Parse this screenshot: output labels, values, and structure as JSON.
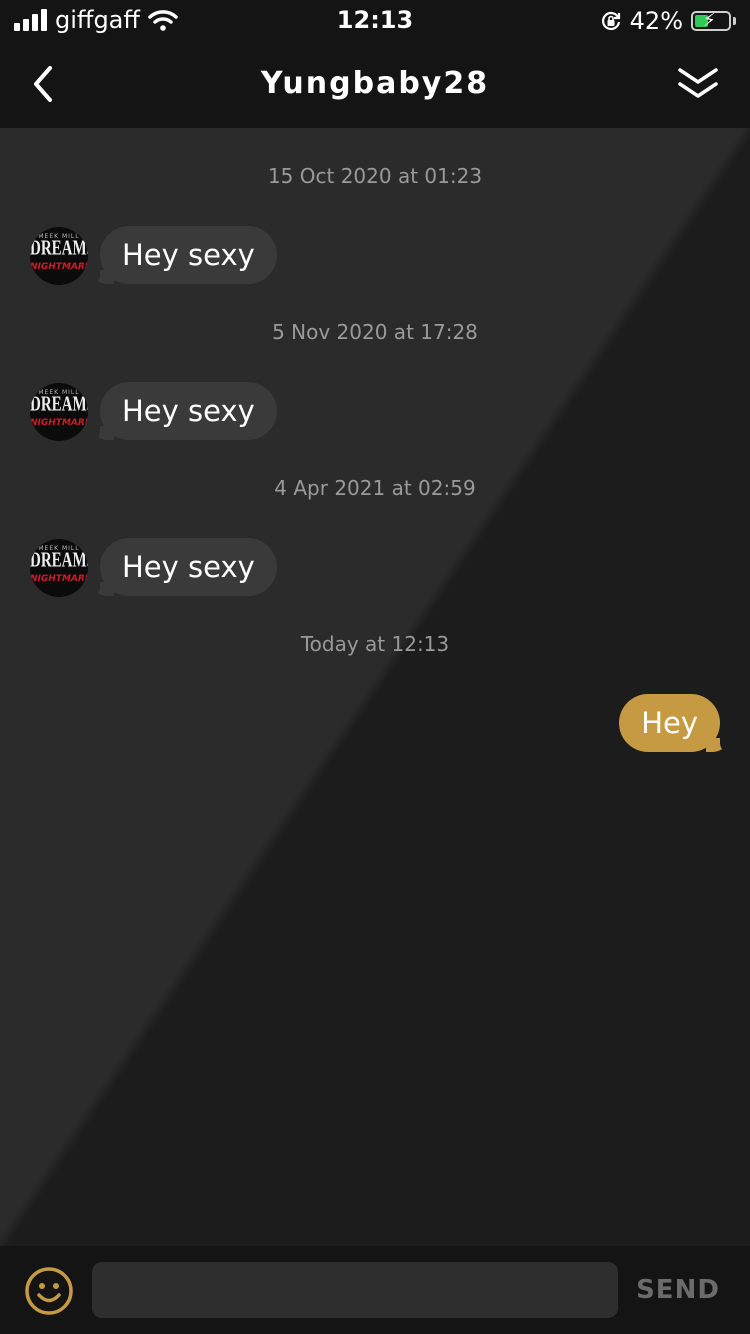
{
  "status_bar": {
    "carrier": "giffgaff",
    "time": "12:13",
    "battery_percent": "42%",
    "battery_level": 0.42,
    "battery_color": "#31c957"
  },
  "header": {
    "title": "Yungbaby28",
    "back_icon": "chevron-left-icon",
    "collapse_icon": "double-chevron-down-icon"
  },
  "avatar": {
    "line1": "MEEK MILL",
    "line2": "DREAMS",
    "line3": "NIGHTMARES"
  },
  "messages": [
    {
      "timestamp": "15 Oct 2020 at 01:23",
      "text": "Hey sexy",
      "direction": "incoming"
    },
    {
      "timestamp": "5 Nov 2020 at 17:28",
      "text": "Hey sexy",
      "direction": "incoming"
    },
    {
      "timestamp": "4 Apr 2021 at 02:59",
      "text": "Hey sexy",
      "direction": "incoming"
    },
    {
      "timestamp": "Today at 12:13",
      "text": "Hey",
      "direction": "outgoing"
    }
  ],
  "composer": {
    "input_value": "",
    "input_placeholder": "",
    "send_label": "SEND",
    "emoji_icon": "smiley-icon"
  },
  "colors": {
    "outgoing_bubble": "#c59a42",
    "incoming_bubble": "#3a3a3a",
    "emoji_icon": "#c59a42"
  }
}
